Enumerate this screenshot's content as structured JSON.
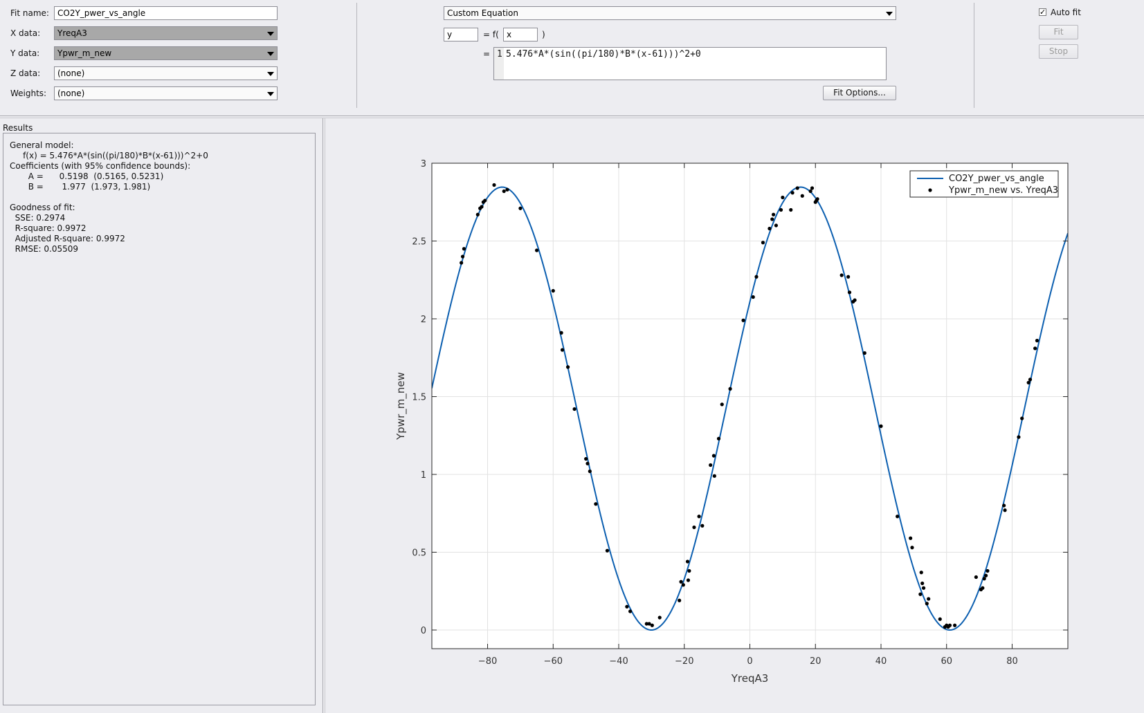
{
  "top": {
    "fit_name_label": "Fit name:",
    "fit_name_value": "CO2Y_pwer_vs_angle",
    "x_data_label": "X data:",
    "x_data_value": "YreqA3",
    "y_data_label": "Y data:",
    "y_data_value": "Ypwr_m_new",
    "z_data_label": "Z data:",
    "z_data_value": "(none)",
    "weights_label": "Weights:",
    "weights_value": "(none)"
  },
  "equation": {
    "type_value": "Custom Equation",
    "y_var": "y",
    "equals_f": "= f(",
    "x_var": "x",
    "close_paren": ")",
    "equals": "=",
    "line_number": "1",
    "expression": "5.476*A*(sin((pi/180)*B*(x-61)))^2+0",
    "fit_options_button": "Fit Options..."
  },
  "controls": {
    "auto_fit_label": "Auto fit",
    "auto_fit_checked": true,
    "check_mark": "✓",
    "fit_button": "Fit",
    "stop_button": "Stop"
  },
  "results": {
    "header": "Results",
    "lines": [
      "General model:",
      "     f(x) = 5.476*A*(sin((pi/180)*B*(x-61)))^2+0",
      "Coefficients (with 95% confidence bounds):",
      "       A =      0.5198  (0.5165, 0.5231)",
      "       B =       1.977  (1.973, 1.981)",
      "",
      "Goodness of fit:",
      "  SSE: 0.2974",
      "  R-square: 0.9972",
      "  Adjusted R-square: 0.9972",
      "  RMSE: 0.05509"
    ]
  },
  "colors": {
    "curve": "#0c5fb0",
    "points": "#000000",
    "grid": "#e2e2e2",
    "plot_bg": "#ffffff",
    "panel_bg": "#ededf1"
  },
  "chart_data": {
    "type": "scatter",
    "xlabel": "YreqA3",
    "ylabel": "Ypwr_m_new",
    "xlim": [
      -97,
      97
    ],
    "ylim": [
      -0.12,
      3
    ],
    "xticks": [
      -80,
      -60,
      -40,
      -20,
      0,
      20,
      40,
      60,
      80
    ],
    "xtick_labels": [
      "−80",
      "−60",
      "−40",
      "−20",
      "0",
      "20",
      "40",
      "60",
      "80"
    ],
    "yticks": [
      0,
      0.5,
      1,
      1.5,
      2,
      2.5,
      3
    ],
    "ytick_labels": [
      "0",
      "0.5",
      "1",
      "1.5",
      "2",
      "2.5",
      "3"
    ],
    "grid": true,
    "legend_position": "top-right",
    "series": [
      {
        "name": "CO2Y_pwer_vs_angle",
        "kind": "line",
        "A": 0.5198,
        "B": 1.977,
        "K": 5.476,
        "shift": 61
      },
      {
        "name": "Ypwr_m_new vs. YreqA3",
        "kind": "scatter",
        "points": [
          [
            -88,
            2.36
          ],
          [
            -87.6,
            2.4
          ],
          [
            -87.2,
            2.45
          ],
          [
            -83,
            2.67
          ],
          [
            -82.3,
            2.71
          ],
          [
            -81.8,
            2.72
          ],
          [
            -81.3,
            2.75
          ],
          [
            -80.8,
            2.76
          ],
          [
            -78,
            2.86
          ],
          [
            -75,
            2.82
          ],
          [
            -74,
            2.83
          ],
          [
            -70,
            2.71
          ],
          [
            -65,
            2.44
          ],
          [
            -60,
            2.18
          ],
          [
            -57.5,
            1.91
          ],
          [
            -57.2,
            1.8
          ],
          [
            -55.5,
            1.69
          ],
          [
            -53.5,
            1.42
          ],
          [
            -50,
            1.1
          ],
          [
            -49.5,
            1.07
          ],
          [
            -48.8,
            1.02
          ],
          [
            -47,
            0.81
          ],
          [
            -43.5,
            0.51
          ],
          [
            -37.5,
            0.15
          ],
          [
            -36.5,
            0.12
          ],
          [
            -31.5,
            0.04
          ],
          [
            -30.7,
            0.04
          ],
          [
            -29.8,
            0.03
          ],
          [
            -27.5,
            0.08
          ],
          [
            -21.5,
            0.19
          ],
          [
            -21,
            0.31
          ],
          [
            -20.3,
            0.29
          ],
          [
            -19,
            0.44
          ],
          [
            -18.8,
            0.32
          ],
          [
            -18.5,
            0.38
          ],
          [
            -17,
            0.66
          ],
          [
            -15.5,
            0.73
          ],
          [
            -14.5,
            0.67
          ],
          [
            -12,
            1.06
          ],
          [
            -11,
            1.12
          ],
          [
            -10.8,
            0.99
          ],
          [
            -9.5,
            1.23
          ],
          [
            -8.5,
            1.45
          ],
          [
            -6,
            1.55
          ],
          [
            -2,
            1.99
          ],
          [
            1,
            2.14
          ],
          [
            2,
            2.27
          ],
          [
            4,
            2.49
          ],
          [
            6,
            2.58
          ],
          [
            6.8,
            2.64
          ],
          [
            7.2,
            2.67
          ],
          [
            8,
            2.6
          ],
          [
            9.5,
            2.7
          ],
          [
            10,
            2.78
          ],
          [
            12.5,
            2.7
          ],
          [
            13,
            2.81
          ],
          [
            14.5,
            2.84
          ],
          [
            16,
            2.79
          ],
          [
            18.5,
            2.82
          ],
          [
            19,
            2.84
          ],
          [
            20,
            2.75
          ],
          [
            20.3,
            2.76
          ],
          [
            20.6,
            2.77
          ],
          [
            28,
            2.28
          ],
          [
            30,
            2.27
          ],
          [
            30.4,
            2.17
          ],
          [
            31.5,
            2.11
          ],
          [
            32,
            2.12
          ],
          [
            35,
            1.78
          ],
          [
            40,
            1.31
          ],
          [
            45,
            0.73
          ],
          [
            49,
            0.59
          ],
          [
            49.5,
            0.53
          ],
          [
            52,
            0.23
          ],
          [
            52.3,
            0.37
          ],
          [
            52.6,
            0.3
          ],
          [
            53,
            0.27
          ],
          [
            54,
            0.17
          ],
          [
            54.5,
            0.2
          ],
          [
            58,
            0.07
          ],
          [
            59.5,
            0.02
          ],
          [
            60,
            0.03
          ],
          [
            60.5,
            0.02
          ],
          [
            61,
            0.03
          ],
          [
            62.5,
            0.03
          ],
          [
            69,
            0.34
          ],
          [
            70.5,
            0.26
          ],
          [
            71,
            0.27
          ],
          [
            71.5,
            0.33
          ],
          [
            72,
            0.35
          ],
          [
            72.5,
            0.38
          ],
          [
            77.5,
            0.8
          ],
          [
            77.8,
            0.77
          ],
          [
            82,
            1.24
          ],
          [
            83,
            1.36
          ],
          [
            85,
            1.59
          ],
          [
            85.5,
            1.61
          ],
          [
            87,
            1.81
          ],
          [
            87.6,
            1.86
          ]
        ]
      }
    ]
  }
}
